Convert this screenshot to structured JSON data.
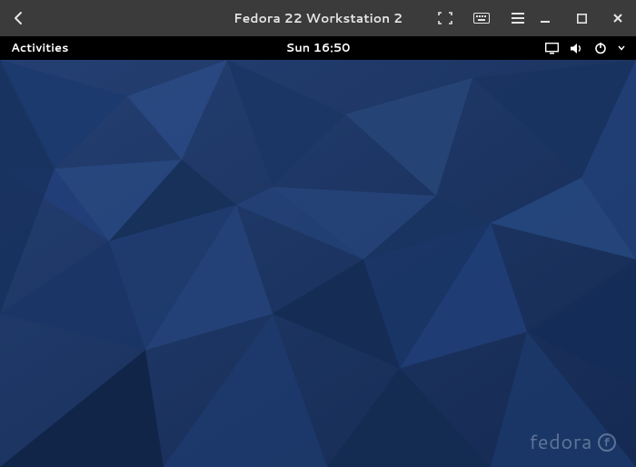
{
  "host": {
    "title": "Fedora 22 Workstation 2",
    "icons": {
      "back": "back-icon",
      "fullscreen": "fullscreen-icon",
      "keyboard": "keyboard-icon",
      "menu": "hamburger-icon",
      "minimize": "minimize-icon",
      "maximize": "maximize-icon",
      "close": "close-icon"
    }
  },
  "gnome": {
    "activities": "Activities",
    "clock": "Sun 16:50",
    "status_icons": {
      "display": "display-icon",
      "volume": "volume-icon",
      "power": "power-icon"
    }
  },
  "desktop": {
    "distro_logo": "fedora",
    "distro_glyph": "f"
  },
  "colors": {
    "host_bar": "#3b3b3b",
    "gnome_bar": "#000000",
    "wallpaper_base": "#1c3566"
  }
}
